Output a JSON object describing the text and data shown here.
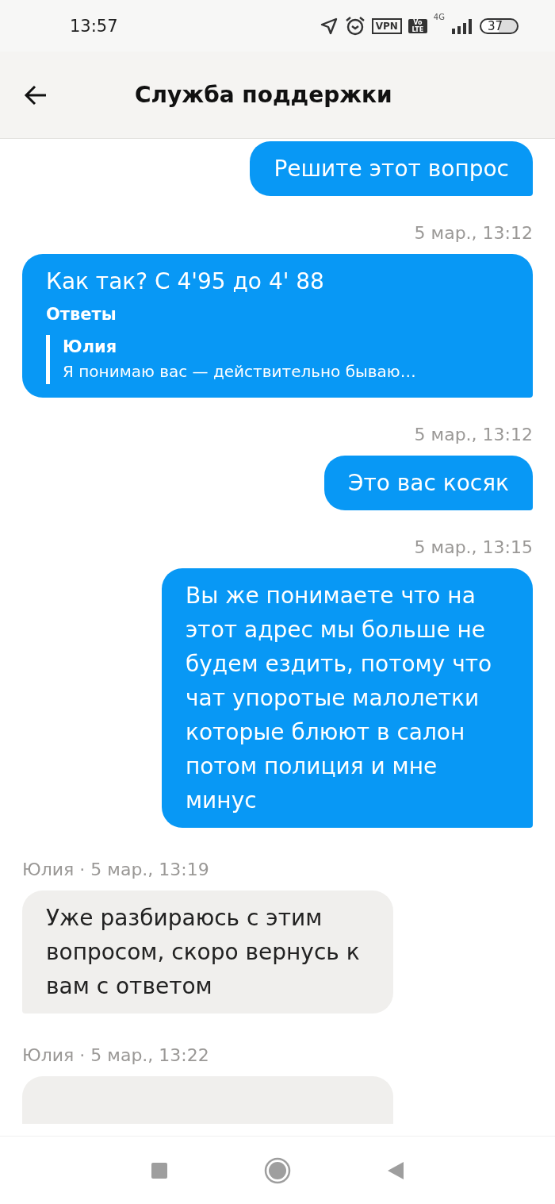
{
  "status_bar": {
    "time": "13:57",
    "vpn": "VPN",
    "volte_top": "Vo",
    "volte_bottom": "LTE",
    "network": "4G",
    "battery": "37"
  },
  "header": {
    "title": "Служба поддержки"
  },
  "feed": [
    {
      "kind": "outgoing",
      "text": "Решите этот вопрос"
    },
    {
      "kind": "timestamp",
      "text": "5 мар., 13:12"
    },
    {
      "kind": "outgoing",
      "text": "Как так? С 4'95 до 4' 88",
      "reply": {
        "heading": "Ответы",
        "author": "Юлия",
        "text": "Я понимаю вас — действительно бываю…"
      }
    },
    {
      "kind": "timestamp",
      "text": "5 мар., 13:12"
    },
    {
      "kind": "outgoing",
      "text": "Это вас косяк"
    },
    {
      "kind": "timestamp",
      "text": "5 мар., 13:15"
    },
    {
      "kind": "outgoing",
      "text": "Вы же понимаете что на этот адрес мы больше не будем ездить, потому что чат упоротые малолетки которые блюют в салон потом полиция и мне минус"
    },
    {
      "kind": "sender",
      "text": "Юлия · 5 мар., 13:19"
    },
    {
      "kind": "incoming",
      "text": "Уже разбираюсь с этим вопросом, скоро вернусь к вам с ответом"
    },
    {
      "kind": "sender",
      "text": "Юлия · 5 мар., 13:22"
    },
    {
      "kind": "incoming_cut"
    }
  ]
}
